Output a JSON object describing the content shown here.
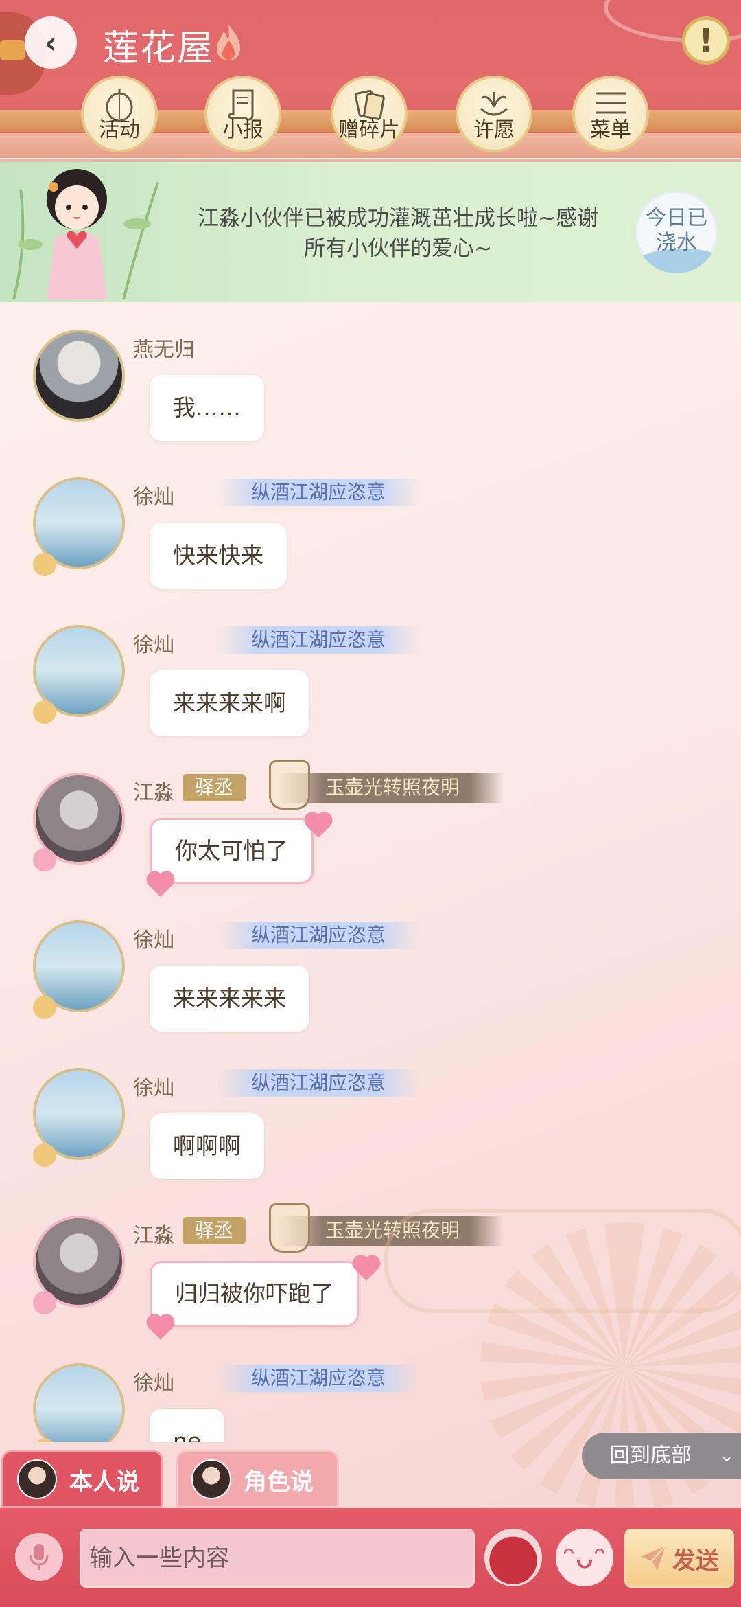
{
  "header": {
    "room_title": "莲花屋",
    "nav": [
      {
        "label": "活动",
        "icon": "lantern-icon"
      },
      {
        "label": "小报",
        "icon": "scroll-icon"
      },
      {
        "label": "赠碎片",
        "icon": "card-icon"
      },
      {
        "label": "许愿",
        "icon": "fountain-icon"
      },
      {
        "label": "菜单",
        "icon": "menu-icon"
      }
    ]
  },
  "banner": {
    "text": "江淼小伙伴已被成功灌溉茁壮成长啦~感谢所有小伙伴的爱心~",
    "water_badge": "今日已浇水"
  },
  "messages": [
    {
      "sender": "燕无归",
      "text": "我……"
    },
    {
      "sender": "徐灿",
      "title": "纵酒江湖应恣意",
      "text": "快来快来"
    },
    {
      "sender": "徐灿",
      "title": "纵酒江湖应恣意",
      "text": "来来来来啊"
    },
    {
      "sender": "江淼",
      "rank": "驿丞",
      "frame_title": "玉壶光转照夜明",
      "text": "你太可怕了"
    },
    {
      "sender": "徐灿",
      "title": "纵酒江湖应恣意",
      "text": "来来来来来"
    },
    {
      "sender": "徐灿",
      "title": "纵酒江湖应恣意",
      "text": "啊啊啊"
    },
    {
      "sender": "江淼",
      "rank": "驿丞",
      "frame_title": "玉壶光转照夜明",
      "text": "归归被你吓跑了"
    },
    {
      "sender": "徐灿",
      "title": "纵酒江湖应恣意",
      "text": "ne"
    }
  ],
  "controls": {
    "back_to_bottom": "回到底部",
    "tab_self": "本人说",
    "tab_role": "角色说",
    "input_placeholder": "输入一些内容",
    "send": "发送"
  },
  "colors": {
    "header_red": "#e0676a",
    "accent_gold": "#c3a266",
    "title_blue": "#5a6fae",
    "send_text": "#c5604e"
  }
}
